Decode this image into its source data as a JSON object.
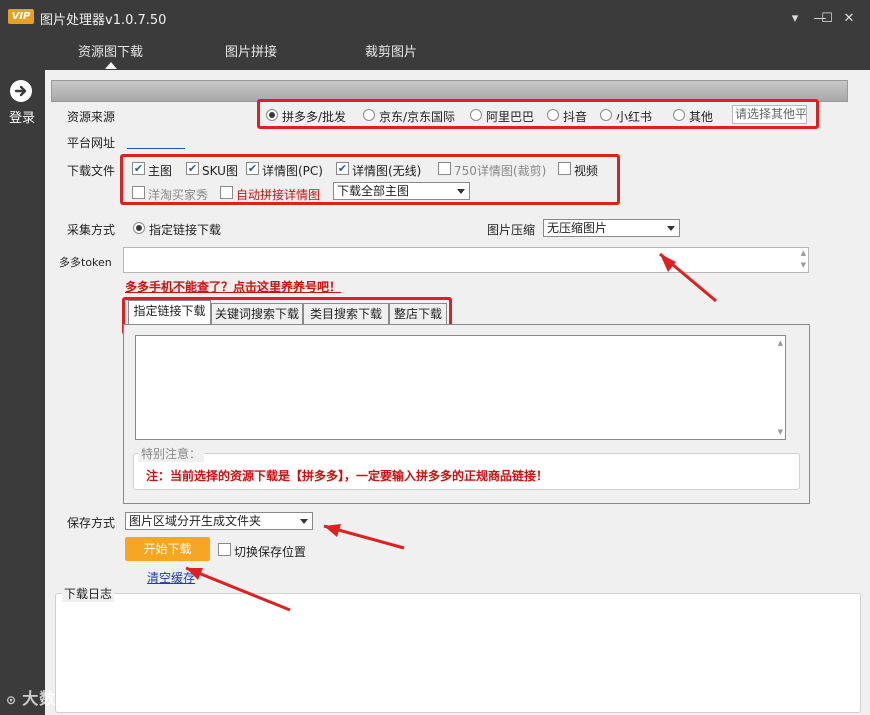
{
  "app": {
    "badge": "VIP",
    "title": "图片处理器v1.0.7.50"
  },
  "window_controls": {
    "menu": "▾",
    "minimize": "—",
    "maximize": "☐",
    "close": "✕"
  },
  "top_tabs": [
    {
      "label": "资源图下载",
      "active": true
    },
    {
      "label": "图片拼接",
      "active": false
    },
    {
      "label": "裁剪图片",
      "active": false
    }
  ],
  "sidebar": {
    "login_label": "登录",
    "login_icon": "arrow-right-circle-icon"
  },
  "source": {
    "label": "资源来源",
    "options": [
      {
        "label": "拼多多/批发",
        "selected": true
      },
      {
        "label": "京东/京东国际",
        "selected": false
      },
      {
        "label": "阿里巴巴",
        "selected": false
      },
      {
        "label": "抖音",
        "selected": false
      },
      {
        "label": "小红书",
        "selected": false
      },
      {
        "label": "其他",
        "selected": false
      }
    ],
    "other_placeholder": "请选择其他平"
  },
  "platform_url": {
    "label": "平台网址"
  },
  "download_files": {
    "label": "下载文件",
    "row1": [
      {
        "label": "主图",
        "checked": true
      },
      {
        "label": "SKU图",
        "checked": true
      },
      {
        "label": "详情图(PC)",
        "checked": true
      },
      {
        "label": "详情图(无线)",
        "checked": true
      },
      {
        "label": "750详情图(裁剪)",
        "checked": false
      },
      {
        "label": "视频",
        "checked": false
      }
    ],
    "row2": [
      {
        "label": "洋淘买家秀",
        "checked": false
      },
      {
        "label": "自动拼接详情图",
        "checked": false
      }
    ],
    "main_image_select": "下载全部主图"
  },
  "collect": {
    "label": "采集方式",
    "option": "指定链接下载"
  },
  "compress": {
    "label": "图片压缩",
    "value": "无压缩图片"
  },
  "token": {
    "label": "多多token",
    "link": "多多手机不能查了？点击这里养养号吧！"
  },
  "sub_tabs": [
    {
      "label": "指定链接下载",
      "active": true
    },
    {
      "label": "关键词搜索下载",
      "active": false
    },
    {
      "label": "类目搜索下载",
      "active": false
    },
    {
      "label": "整店下载",
      "active": false
    }
  ],
  "notice": {
    "title": "特别注意：",
    "text": "注：当前选择的资源下载是【拼多多】，一定要输入拼多多的正规商品链接！"
  },
  "save": {
    "label": "保存方式",
    "value": "图片区域分开生成文件夹",
    "start_button": "开始下载",
    "switch_label": "切换保存位置",
    "clear_cache": "清空缓存"
  },
  "log": {
    "label": "下载日志"
  },
  "watermark": "大数跨境",
  "colors": {
    "accent": "#f5a623",
    "highlight": "#e02020",
    "link": "#1a3bbd",
    "chrome": "#3b3b3b"
  }
}
